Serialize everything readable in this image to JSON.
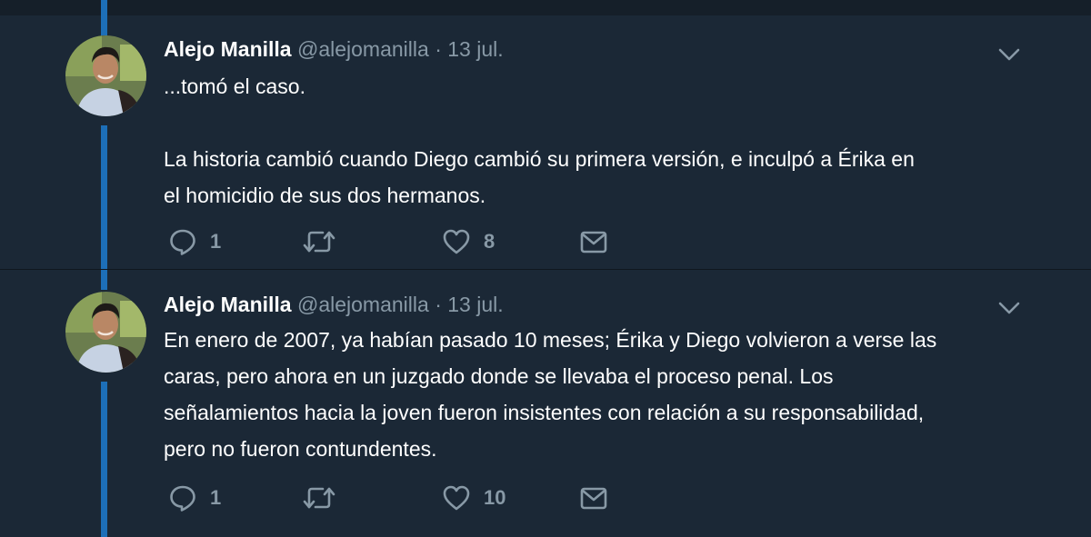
{
  "tweets": [
    {
      "author_name": "Alejo Manilla",
      "handle": "@alejomanilla",
      "separator": "·",
      "date": "13 jul.",
      "lines": [
        "...tomó el caso.",
        "",
        "La historia cambió cuando Diego cambió su primera versión, e inculpó a Érika en",
        "el homicidio de sus dos hermanos."
      ],
      "reply_count": "1",
      "retweet_count": "",
      "like_count": "8"
    },
    {
      "author_name": "Alejo Manilla",
      "handle": "@alejomanilla",
      "separator": "·",
      "date": "13 jul.",
      "lines": [
        "En enero de 2007, ya habían pasado 10 meses; Érika y Diego volvieron a verse las",
        "caras, pero ahora en un juzgado donde se llevaba el proceso penal. Los",
        "señalamientos hacia la joven fueron insistentes con relación a su responsabilidad,",
        "pero no fueron contundentes."
      ],
      "reply_count": "1",
      "retweet_count": "",
      "like_count": "10"
    }
  ],
  "icons": {
    "reply": "reply-icon",
    "retweet": "retweet-icon",
    "like": "heart-icon",
    "message": "direct-message-icon",
    "menu": "chevron-down-icon",
    "avatar": "profile-photo"
  },
  "colors": {
    "background": "#1b2836",
    "thread_line": "#1d6fb8",
    "text": "#ffffff",
    "secondary_text": "#8899a6"
  }
}
